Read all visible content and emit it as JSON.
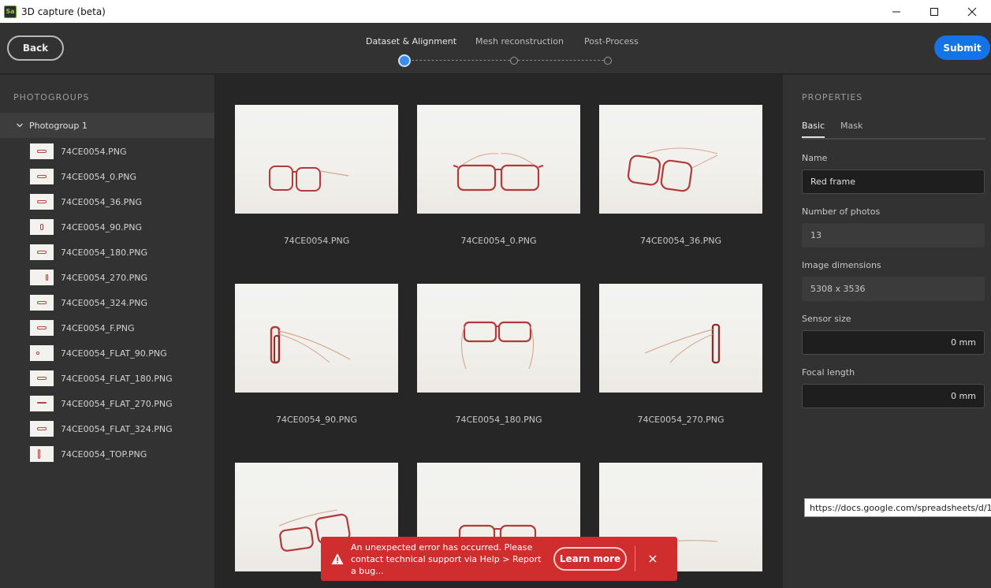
{
  "window": {
    "title": "3D capture (beta)",
    "app_icon_text": "Sa",
    "icons": [
      "minimize-icon",
      "maximize-icon",
      "close-icon"
    ]
  },
  "header": {
    "back_label": "Back",
    "submit_label": "Submit",
    "steps": [
      "Dataset & Alignment",
      "Mesh reconstruction",
      "Post-Process"
    ],
    "active_step": 0,
    "accent_color": "#1473e6"
  },
  "photogroups": {
    "heading": "PHOTOGROUPS",
    "group_label": "Photogroup 1",
    "files": [
      "74CE0054.PNG",
      "74CE0054_0.PNG",
      "74CE0054_36.PNG",
      "74CE0054_90.PNG",
      "74CE0054_180.PNG",
      "74CE0054_270.PNG",
      "74CE0054_324.PNG",
      "74CE0054_F.PNG",
      "74CE0054_FLAT_90.PNG",
      "74CE0054_FLAT_180.PNG",
      "74CE0054_FLAT_270.PNG",
      "74CE0054_FLAT_324.PNG",
      "74CE0054_TOP.PNG"
    ]
  },
  "gallery": {
    "cards": [
      "74CE0054.PNG",
      "74CE0054_0.PNG",
      "74CE0054_36.PNG",
      "74CE0054_90.PNG",
      "74CE0054_180.PNG",
      "74CE0054_270.PNG",
      "",
      "",
      ""
    ]
  },
  "properties": {
    "heading": "PROPERTIES",
    "tabs": [
      "Basic",
      "Mask"
    ],
    "name_label": "Name",
    "name_value": "Red frame",
    "photos_label": "Number of photos",
    "photos_value": "13",
    "dims_label": "Image dimensions",
    "dims_value": "5308 x 3536",
    "sensor_label": "Sensor size",
    "sensor_value": "0 mm",
    "focal_label": "Focal length",
    "focal_value": "0 mm"
  },
  "tooltip": {
    "text": "https://docs.google.com/spreadsheets/d/1E"
  },
  "error_toast": {
    "message": "An unexpected error has occurred. Please contact technical support via Help > Report a bug...",
    "learn_more_label": "Learn more",
    "color": "#d02e2e",
    "icon": "warning-icon"
  }
}
